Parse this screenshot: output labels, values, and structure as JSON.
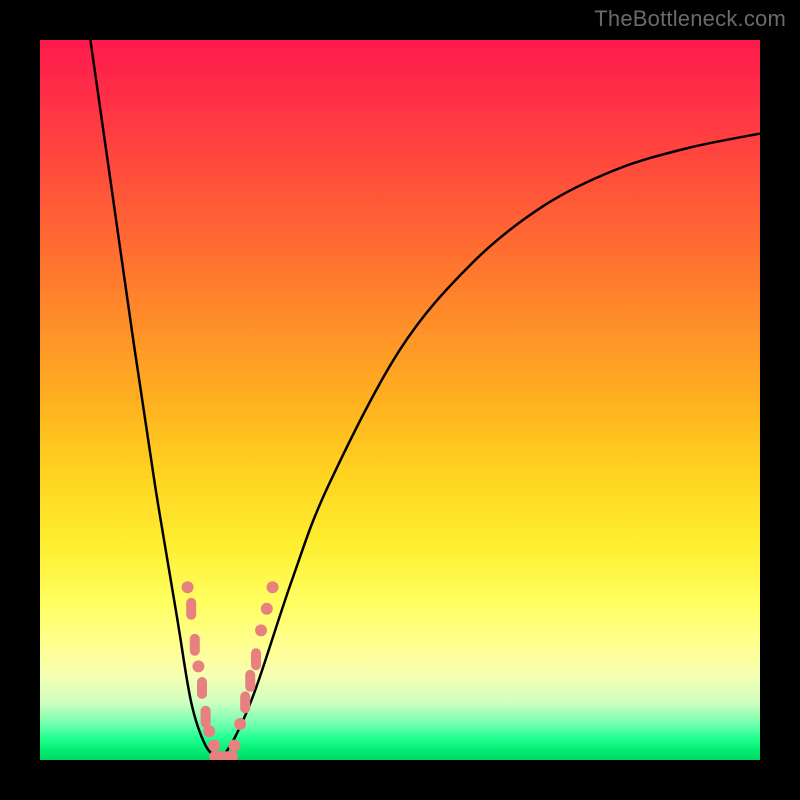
{
  "watermark": {
    "text": "TheBottleneck.com"
  },
  "chart_data": {
    "type": "line",
    "title": "",
    "xlabel": "",
    "ylabel": "",
    "xlim": [
      0,
      100
    ],
    "ylim": [
      0,
      100
    ],
    "series": [
      {
        "name": "bottleneck-curve-left",
        "x": [
          7,
          10,
          13,
          16,
          19,
          21,
          23,
          25
        ],
        "values": [
          100,
          79,
          58,
          38,
          20,
          8,
          2,
          0
        ]
      },
      {
        "name": "bottleneck-curve-right",
        "x": [
          25,
          27,
          30,
          35,
          40,
          50,
          60,
          70,
          80,
          90,
          100
        ],
        "values": [
          0,
          3,
          10,
          25,
          38,
          57,
          69,
          77,
          82,
          85,
          87
        ]
      }
    ],
    "markers": {
      "name": "highlighted-points",
      "color": "#e98080",
      "points": [
        {
          "x": 20.5,
          "y": 24,
          "shape": "round"
        },
        {
          "x": 21.0,
          "y": 21,
          "shape": "bar-v"
        },
        {
          "x": 21.5,
          "y": 16,
          "shape": "bar-v"
        },
        {
          "x": 22.0,
          "y": 13,
          "shape": "round"
        },
        {
          "x": 22.5,
          "y": 10,
          "shape": "bar-v"
        },
        {
          "x": 23.0,
          "y": 6,
          "shape": "bar-v"
        },
        {
          "x": 23.5,
          "y": 4,
          "shape": "round"
        },
        {
          "x": 24.2,
          "y": 2,
          "shape": "round"
        },
        {
          "x": 25.0,
          "y": 0.5,
          "shape": "bar-h"
        },
        {
          "x": 26.0,
          "y": 0.5,
          "shape": "bar-h"
        },
        {
          "x": 27.0,
          "y": 2,
          "shape": "round"
        },
        {
          "x": 27.8,
          "y": 5,
          "shape": "round"
        },
        {
          "x": 28.5,
          "y": 8,
          "shape": "bar-v"
        },
        {
          "x": 29.2,
          "y": 11,
          "shape": "bar-v"
        },
        {
          "x": 30.0,
          "y": 14,
          "shape": "bar-v"
        },
        {
          "x": 30.7,
          "y": 18,
          "shape": "round"
        },
        {
          "x": 31.5,
          "y": 21,
          "shape": "round"
        },
        {
          "x": 32.3,
          "y": 24,
          "shape": "round"
        }
      ]
    },
    "colors": {
      "curve": "#000000",
      "marker": "#e98080",
      "frame": "#000000"
    }
  }
}
